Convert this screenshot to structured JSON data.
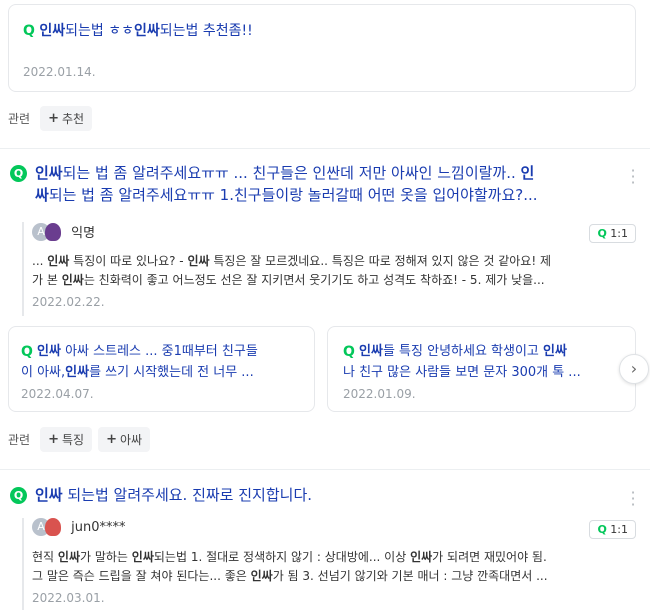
{
  "top_card": {
    "title_parts": [
      "인싸",
      "되는법 ㅎㅎ",
      "인싸",
      "되는법 추천좀!!"
    ],
    "date": "2022.01.14."
  },
  "related_1": {
    "label": "관련",
    "chips": [
      "추천"
    ]
  },
  "result_1": {
    "title_line1_parts": [
      "인싸",
      "되는 법 좀 알려주세요ㅠㅠ ... 친구들은 인싼데 저만 아싸인 느낌이랄까.. ",
      "인"
    ],
    "title_line2_parts": [
      "싸",
      "되는 법 좀 알려주세요ㅠㅠ 1.친구들이랑 놀러갈때 어떤 옷을 입어야할까요?..."
    ],
    "answer": {
      "avatar_letter": "A",
      "username": "익명",
      "badge": "1:1",
      "snippet_line1": [
        "... ",
        "인싸",
        " 특징이 따로 있나요? - ",
        "인싸",
        " 특징은 잘 모르겠네요.. 특징은 따로 정해져 있지 않은 것 같아요! 제"
      ],
      "snippet_line2": [
        "가 본 ",
        "인싸",
        "는 친화력이 좋고 어느정도 선은 잘 지키면서 웃기기도 하고 성격도 착하죠! - 5. 제가 낮을..."
      ],
      "date": "2022.02.22."
    },
    "sub_cards": [
      {
        "line1": [
          "인싸",
          " 아싸 스트레스 ... 중1때부터 친구들"
        ],
        "line2": [
          "이 아싸,",
          "인싸",
          "를 쓰기 시작했는데 전 너무 ..."
        ],
        "date": "2022.04.07."
      },
      {
        "line1": [
          "인싸",
          "들 특징 안녕하세요 학생이고 ",
          "인싸"
        ],
        "line2": [
          "나 친구 많은 사람들 보면 문자 300개 톡 ..."
        ],
        "date": "2022.01.09."
      }
    ]
  },
  "related_2": {
    "label": "관련",
    "chips": [
      "특징",
      "아싸"
    ]
  },
  "result_2": {
    "title_parts": [
      "인싸",
      " 되는법 알려주세요. 진짜로 진지합니다."
    ],
    "answer": {
      "avatar_letter": "A",
      "username": "jun0****",
      "badge": "1:1",
      "snippet_line1": [
        "현직 ",
        "인싸",
        "가 말하는 ",
        "인싸",
        "되는법 1. 절대로 정색하지 않기 : 상대방에... 이상 ",
        "인싸",
        "가 되려면 재밌어야 됨."
      ],
      "snippet_line2": [
        "그 말은 즉슨 드립을 잘 쳐야 된다는... 좋은 ",
        "인싸",
        "가 됨 3. 선넘기 않기와 기본 매너 : 그냥 깐족대면서 ..."
      ],
      "date": "2022.03.01."
    }
  },
  "icons": {
    "question": "Q",
    "plus": "+",
    "next": "›",
    "reply": "Q"
  },
  "colors": {
    "accent": "#03c75a",
    "link": "#1a3cb0",
    "date": "#9aa0a6"
  }
}
